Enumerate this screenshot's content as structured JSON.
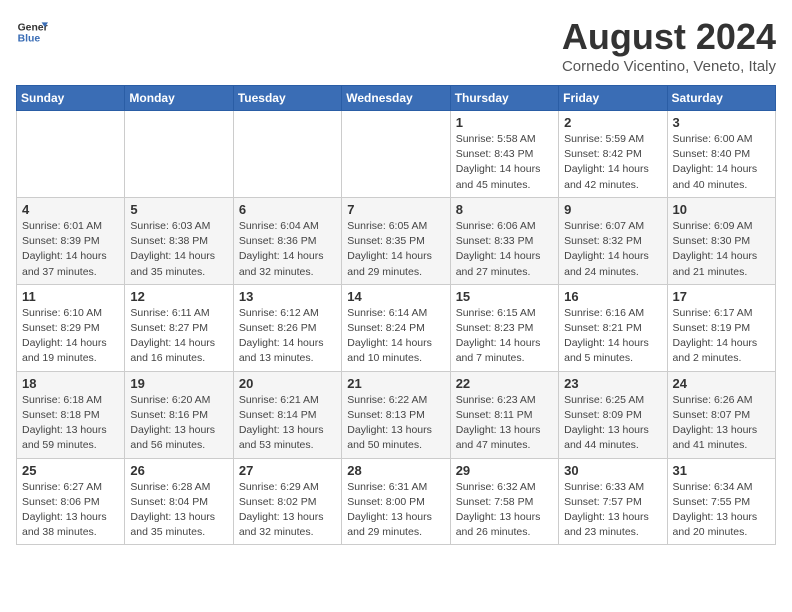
{
  "header": {
    "logo_general": "General",
    "logo_blue": "Blue",
    "main_title": "August 2024",
    "subtitle": "Cornedo Vicentino, Veneto, Italy"
  },
  "days_of_week": [
    "Sunday",
    "Monday",
    "Tuesday",
    "Wednesday",
    "Thursday",
    "Friday",
    "Saturday"
  ],
  "weeks": [
    [
      {
        "num": "",
        "detail": ""
      },
      {
        "num": "",
        "detail": ""
      },
      {
        "num": "",
        "detail": ""
      },
      {
        "num": "",
        "detail": ""
      },
      {
        "num": "1",
        "detail": "Sunrise: 5:58 AM\nSunset: 8:43 PM\nDaylight: 14 hours\nand 45 minutes."
      },
      {
        "num": "2",
        "detail": "Sunrise: 5:59 AM\nSunset: 8:42 PM\nDaylight: 14 hours\nand 42 minutes."
      },
      {
        "num": "3",
        "detail": "Sunrise: 6:00 AM\nSunset: 8:40 PM\nDaylight: 14 hours\nand 40 minutes."
      }
    ],
    [
      {
        "num": "4",
        "detail": "Sunrise: 6:01 AM\nSunset: 8:39 PM\nDaylight: 14 hours\nand 37 minutes."
      },
      {
        "num": "5",
        "detail": "Sunrise: 6:03 AM\nSunset: 8:38 PM\nDaylight: 14 hours\nand 35 minutes."
      },
      {
        "num": "6",
        "detail": "Sunrise: 6:04 AM\nSunset: 8:36 PM\nDaylight: 14 hours\nand 32 minutes."
      },
      {
        "num": "7",
        "detail": "Sunrise: 6:05 AM\nSunset: 8:35 PM\nDaylight: 14 hours\nand 29 minutes."
      },
      {
        "num": "8",
        "detail": "Sunrise: 6:06 AM\nSunset: 8:33 PM\nDaylight: 14 hours\nand 27 minutes."
      },
      {
        "num": "9",
        "detail": "Sunrise: 6:07 AM\nSunset: 8:32 PM\nDaylight: 14 hours\nand 24 minutes."
      },
      {
        "num": "10",
        "detail": "Sunrise: 6:09 AM\nSunset: 8:30 PM\nDaylight: 14 hours\nand 21 minutes."
      }
    ],
    [
      {
        "num": "11",
        "detail": "Sunrise: 6:10 AM\nSunset: 8:29 PM\nDaylight: 14 hours\nand 19 minutes."
      },
      {
        "num": "12",
        "detail": "Sunrise: 6:11 AM\nSunset: 8:27 PM\nDaylight: 14 hours\nand 16 minutes."
      },
      {
        "num": "13",
        "detail": "Sunrise: 6:12 AM\nSunset: 8:26 PM\nDaylight: 14 hours\nand 13 minutes."
      },
      {
        "num": "14",
        "detail": "Sunrise: 6:14 AM\nSunset: 8:24 PM\nDaylight: 14 hours\nand 10 minutes."
      },
      {
        "num": "15",
        "detail": "Sunrise: 6:15 AM\nSunset: 8:23 PM\nDaylight: 14 hours\nand 7 minutes."
      },
      {
        "num": "16",
        "detail": "Sunrise: 6:16 AM\nSunset: 8:21 PM\nDaylight: 14 hours\nand 5 minutes."
      },
      {
        "num": "17",
        "detail": "Sunrise: 6:17 AM\nSunset: 8:19 PM\nDaylight: 14 hours\nand 2 minutes."
      }
    ],
    [
      {
        "num": "18",
        "detail": "Sunrise: 6:18 AM\nSunset: 8:18 PM\nDaylight: 13 hours\nand 59 minutes."
      },
      {
        "num": "19",
        "detail": "Sunrise: 6:20 AM\nSunset: 8:16 PM\nDaylight: 13 hours\nand 56 minutes."
      },
      {
        "num": "20",
        "detail": "Sunrise: 6:21 AM\nSunset: 8:14 PM\nDaylight: 13 hours\nand 53 minutes."
      },
      {
        "num": "21",
        "detail": "Sunrise: 6:22 AM\nSunset: 8:13 PM\nDaylight: 13 hours\nand 50 minutes."
      },
      {
        "num": "22",
        "detail": "Sunrise: 6:23 AM\nSunset: 8:11 PM\nDaylight: 13 hours\nand 47 minutes."
      },
      {
        "num": "23",
        "detail": "Sunrise: 6:25 AM\nSunset: 8:09 PM\nDaylight: 13 hours\nand 44 minutes."
      },
      {
        "num": "24",
        "detail": "Sunrise: 6:26 AM\nSunset: 8:07 PM\nDaylight: 13 hours\nand 41 minutes."
      }
    ],
    [
      {
        "num": "25",
        "detail": "Sunrise: 6:27 AM\nSunset: 8:06 PM\nDaylight: 13 hours\nand 38 minutes."
      },
      {
        "num": "26",
        "detail": "Sunrise: 6:28 AM\nSunset: 8:04 PM\nDaylight: 13 hours\nand 35 minutes."
      },
      {
        "num": "27",
        "detail": "Sunrise: 6:29 AM\nSunset: 8:02 PM\nDaylight: 13 hours\nand 32 minutes."
      },
      {
        "num": "28",
        "detail": "Sunrise: 6:31 AM\nSunset: 8:00 PM\nDaylight: 13 hours\nand 29 minutes."
      },
      {
        "num": "29",
        "detail": "Sunrise: 6:32 AM\nSunset: 7:58 PM\nDaylight: 13 hours\nand 26 minutes."
      },
      {
        "num": "30",
        "detail": "Sunrise: 6:33 AM\nSunset: 7:57 PM\nDaylight: 13 hours\nand 23 minutes."
      },
      {
        "num": "31",
        "detail": "Sunrise: 6:34 AM\nSunset: 7:55 PM\nDaylight: 13 hours\nand 20 minutes."
      }
    ]
  ]
}
